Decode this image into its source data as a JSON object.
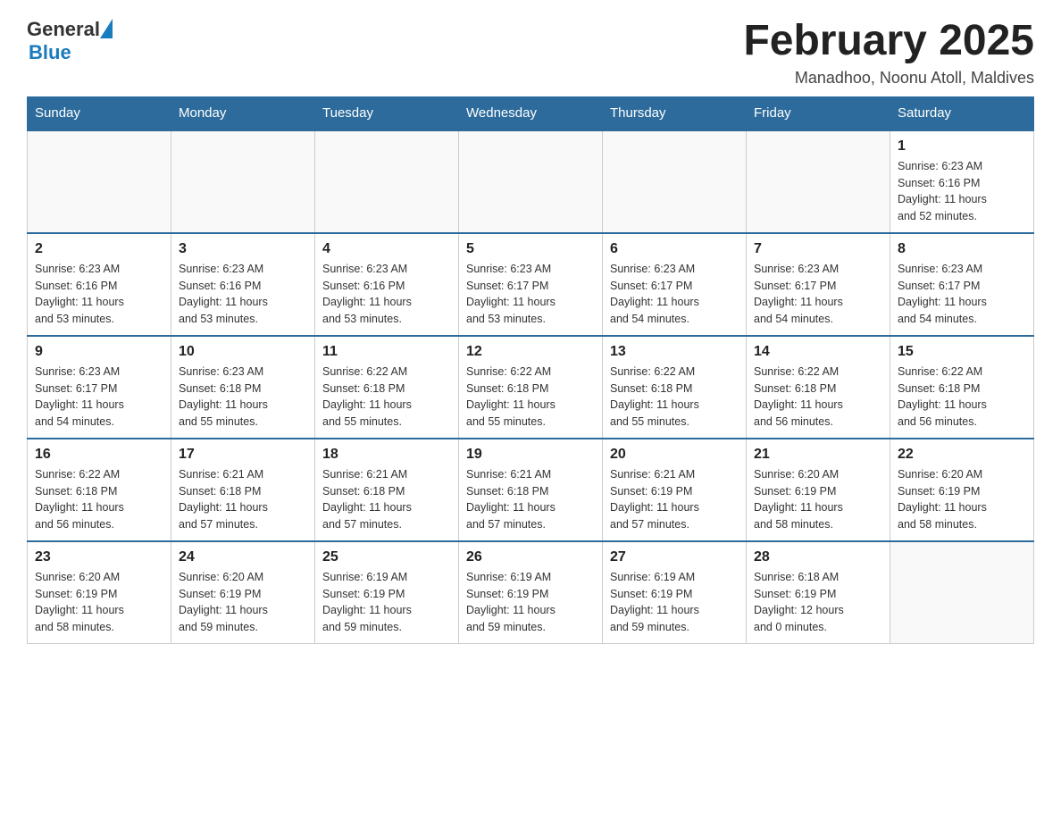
{
  "header": {
    "logo_general": "General",
    "logo_blue": "Blue",
    "month_title": "February 2025",
    "location": "Manadhoo, Noonu Atoll, Maldives"
  },
  "days_of_week": [
    "Sunday",
    "Monday",
    "Tuesday",
    "Wednesday",
    "Thursday",
    "Friday",
    "Saturday"
  ],
  "weeks": [
    [
      {
        "day": "",
        "info": ""
      },
      {
        "day": "",
        "info": ""
      },
      {
        "day": "",
        "info": ""
      },
      {
        "day": "",
        "info": ""
      },
      {
        "day": "",
        "info": ""
      },
      {
        "day": "",
        "info": ""
      },
      {
        "day": "1",
        "info": "Sunrise: 6:23 AM\nSunset: 6:16 PM\nDaylight: 11 hours\nand 52 minutes."
      }
    ],
    [
      {
        "day": "2",
        "info": "Sunrise: 6:23 AM\nSunset: 6:16 PM\nDaylight: 11 hours\nand 53 minutes."
      },
      {
        "day": "3",
        "info": "Sunrise: 6:23 AM\nSunset: 6:16 PM\nDaylight: 11 hours\nand 53 minutes."
      },
      {
        "day": "4",
        "info": "Sunrise: 6:23 AM\nSunset: 6:16 PM\nDaylight: 11 hours\nand 53 minutes."
      },
      {
        "day": "5",
        "info": "Sunrise: 6:23 AM\nSunset: 6:17 PM\nDaylight: 11 hours\nand 53 minutes."
      },
      {
        "day": "6",
        "info": "Sunrise: 6:23 AM\nSunset: 6:17 PM\nDaylight: 11 hours\nand 54 minutes."
      },
      {
        "day": "7",
        "info": "Sunrise: 6:23 AM\nSunset: 6:17 PM\nDaylight: 11 hours\nand 54 minutes."
      },
      {
        "day": "8",
        "info": "Sunrise: 6:23 AM\nSunset: 6:17 PM\nDaylight: 11 hours\nand 54 minutes."
      }
    ],
    [
      {
        "day": "9",
        "info": "Sunrise: 6:23 AM\nSunset: 6:17 PM\nDaylight: 11 hours\nand 54 minutes."
      },
      {
        "day": "10",
        "info": "Sunrise: 6:23 AM\nSunset: 6:18 PM\nDaylight: 11 hours\nand 55 minutes."
      },
      {
        "day": "11",
        "info": "Sunrise: 6:22 AM\nSunset: 6:18 PM\nDaylight: 11 hours\nand 55 minutes."
      },
      {
        "day": "12",
        "info": "Sunrise: 6:22 AM\nSunset: 6:18 PM\nDaylight: 11 hours\nand 55 minutes."
      },
      {
        "day": "13",
        "info": "Sunrise: 6:22 AM\nSunset: 6:18 PM\nDaylight: 11 hours\nand 55 minutes."
      },
      {
        "day": "14",
        "info": "Sunrise: 6:22 AM\nSunset: 6:18 PM\nDaylight: 11 hours\nand 56 minutes."
      },
      {
        "day": "15",
        "info": "Sunrise: 6:22 AM\nSunset: 6:18 PM\nDaylight: 11 hours\nand 56 minutes."
      }
    ],
    [
      {
        "day": "16",
        "info": "Sunrise: 6:22 AM\nSunset: 6:18 PM\nDaylight: 11 hours\nand 56 minutes."
      },
      {
        "day": "17",
        "info": "Sunrise: 6:21 AM\nSunset: 6:18 PM\nDaylight: 11 hours\nand 57 minutes."
      },
      {
        "day": "18",
        "info": "Sunrise: 6:21 AM\nSunset: 6:18 PM\nDaylight: 11 hours\nand 57 minutes."
      },
      {
        "day": "19",
        "info": "Sunrise: 6:21 AM\nSunset: 6:18 PM\nDaylight: 11 hours\nand 57 minutes."
      },
      {
        "day": "20",
        "info": "Sunrise: 6:21 AM\nSunset: 6:19 PM\nDaylight: 11 hours\nand 57 minutes."
      },
      {
        "day": "21",
        "info": "Sunrise: 6:20 AM\nSunset: 6:19 PM\nDaylight: 11 hours\nand 58 minutes."
      },
      {
        "day": "22",
        "info": "Sunrise: 6:20 AM\nSunset: 6:19 PM\nDaylight: 11 hours\nand 58 minutes."
      }
    ],
    [
      {
        "day": "23",
        "info": "Sunrise: 6:20 AM\nSunset: 6:19 PM\nDaylight: 11 hours\nand 58 minutes."
      },
      {
        "day": "24",
        "info": "Sunrise: 6:20 AM\nSunset: 6:19 PM\nDaylight: 11 hours\nand 59 minutes."
      },
      {
        "day": "25",
        "info": "Sunrise: 6:19 AM\nSunset: 6:19 PM\nDaylight: 11 hours\nand 59 minutes."
      },
      {
        "day": "26",
        "info": "Sunrise: 6:19 AM\nSunset: 6:19 PM\nDaylight: 11 hours\nand 59 minutes."
      },
      {
        "day": "27",
        "info": "Sunrise: 6:19 AM\nSunset: 6:19 PM\nDaylight: 11 hours\nand 59 minutes."
      },
      {
        "day": "28",
        "info": "Sunrise: 6:18 AM\nSunset: 6:19 PM\nDaylight: 12 hours\nand 0 minutes."
      },
      {
        "day": "",
        "info": ""
      }
    ]
  ]
}
